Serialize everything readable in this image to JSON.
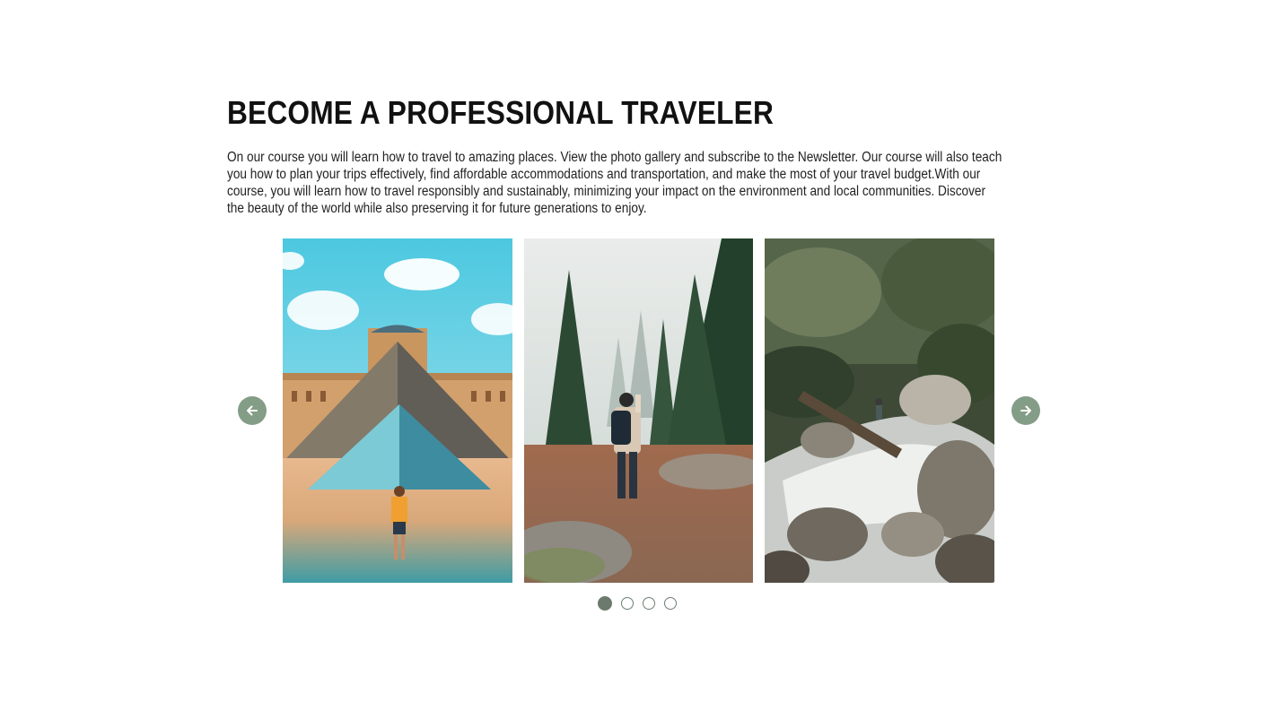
{
  "heading": "BECOME A PROFESSIONAL TRAVELER",
  "description": "On our course you will learn how to travel to amazing places. View the photo gallery and subscribe to the Newsletter. Our course will also teach you how to plan your trips effectively, find affordable accommodations and transportation, and make the most of your travel budget.With our course, you will learn how to travel responsibly and sustainably, minimizing your impact on the environment and local communities. Discover the beauty of the world while also preserving it for future generations to enjoy.",
  "slider": {
    "prev_icon": "arrow-left-icon",
    "next_icon": "arrow-right-icon",
    "slides": [
      {
        "subject": "louvre-pyramid-photo"
      },
      {
        "subject": "forest-hiker-photo"
      },
      {
        "subject": "river-rocks-photo"
      }
    ],
    "dots_total": 4,
    "active_dot": 1
  },
  "colors": {
    "accent": "#849d86",
    "dot_active": "#6b7a6d",
    "heading": "#111111",
    "text": "#222222"
  }
}
